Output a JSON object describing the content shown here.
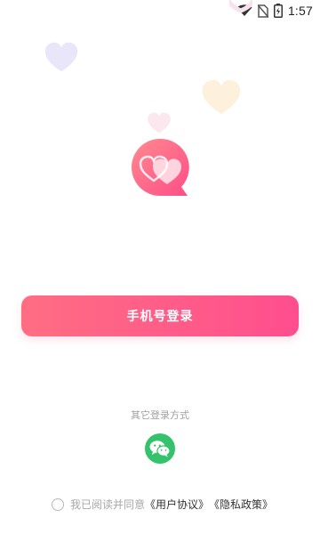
{
  "status_bar": {
    "time": "1:57",
    "icons": [
      "wifi-icon",
      "no-sim-icon",
      "battery-charging-icon"
    ]
  },
  "decorations": [
    "heart-icon",
    "heart-icon",
    "heart-icon",
    "heart-icon"
  ],
  "logo": {
    "icon": "double-heart-chat-bubble-icon",
    "colors": {
      "start": "#ff8a8f",
      "end": "#ff4d88"
    }
  },
  "login": {
    "phone_button_label": "手机号登录",
    "gradient": {
      "start": "#ff6d83",
      "end": "#ff4e8e"
    }
  },
  "other_login": {
    "title": "其它登录方式",
    "wechat_icon": "wechat-icon",
    "wechat_color": "#35c26d"
  },
  "agreement": {
    "checked": false,
    "prefix": "我已阅读并同意",
    "user_agreement": "《用户协议》",
    "privacy_policy": "《隐私政策》"
  }
}
